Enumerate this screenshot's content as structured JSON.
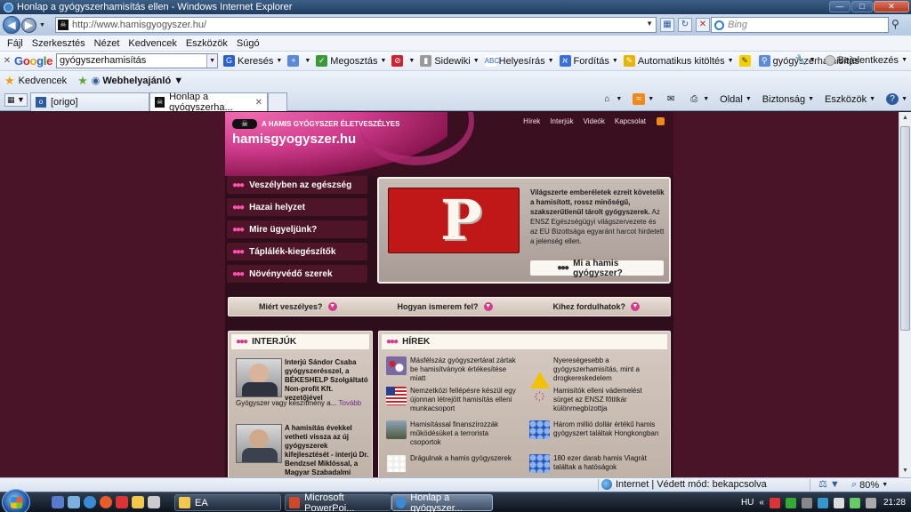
{
  "window": {
    "title": "Honlap a gyógyszerhamisítás ellen - Windows Internet Explorer"
  },
  "address": {
    "url": "http://www.hamisgyogyszer.hu/",
    "search_placeholder": "Bing"
  },
  "menu": [
    "Fájl",
    "Szerkesztés",
    "Nézet",
    "Kedvencek",
    "Eszközök",
    "Súgó"
  ],
  "google_toolbar": {
    "logo": "Google",
    "query": "gyógyszerhamisítás",
    "search_label": "Keresés",
    "share_label": "Megosztás",
    "sidewiki_label": "Sidewiki",
    "spell_label": "Helyesírás",
    "translate_label": "Fordítás",
    "autofill_label": "Automatikus kitöltés",
    "highlight_term": "gyógyszerhamisítás",
    "signin_label": "Bejelentkezés"
  },
  "favorites": {
    "favorites_label": "Kedvencek",
    "web_slice_label": "Webhelyajánló"
  },
  "tabs": [
    {
      "label": "[origo]"
    },
    {
      "label": "Honlap a gyógyszerha..."
    }
  ],
  "command_bar": {
    "page_label": "Oldal",
    "safety_label": "Biztonság",
    "tools_label": "Eszközök"
  },
  "site": {
    "tagline": "A HAMIS GYÓGYSZER ÉLETVESZÉLYES",
    "name": "hamisgyogyszer.hu",
    "top_nav": [
      "Hírek",
      "Interjúk",
      "Videók",
      "Kapcsolat"
    ],
    "side_nav": [
      "Veszélyben az egészség",
      "Hazai helyzet",
      "Mire ügyeljünk?",
      "Táplálék-kiegészítők",
      "Növényvédő szerek"
    ],
    "feature": {
      "headline": "Világszerte emberéletek ezreit követelik a hamisított, rossz minőségű, szakszerűtlenül tárolt gyógyszerek.",
      "body": " Az ENSZ Egészségügyi világszervezete és az EU Bizottsága egyaránt harcot hirdetett a jelenség ellen.",
      "button": "Mi a hamis gyógyszer?"
    },
    "questions": [
      "Miért veszélyes?",
      "Hogyan ismerem fel?",
      "Kihez fordulhatok?"
    ],
    "interviews_title": "INTERJÚK",
    "interviews": [
      {
        "title": "Interjú Sándor Csaba gyógyszerésszel, a BÉKESHELP Szolgáltató Non-profit Kft. vezetőjével",
        "body": "Gyógyszer vagy készítmény a...",
        "more": "Tovább"
      },
      {
        "title": "A hamisítás évekkel vetheti vissza az új gyógyszerek kifejlesztését - interjú Dr. Bendzsel Miklóssal, a Magyar Szabadalmi Hivatal",
        "body": "",
        "more": ""
      }
    ],
    "news_title": "HÍREK",
    "news": [
      "Másfélszáz gyógyszertárat zártak be hamisítványok értékesítése miatt",
      "Nyereségesebb a gyógyszerhamisítás, mint a drogkereskedelem",
      "Nemzetközi fellépésre készül egy újonnan létrejött hamisítás elleni munkacsoport",
      "Hamisítók elleni vádemelést sürget az ENSZ főtitkár különmegbízottja",
      "Hamisítással finanszírozzák működésüket a terrorista csoportok",
      "Három millió dollár értékű hamis gyógyszert találtak Hongkongban",
      "Drágulnak a hamis gyógyszerek",
      "180 ezer darab hamis Viagrát találtak a hatóságok"
    ]
  },
  "status": {
    "zone": "Internet | Védett mód: bekapcsolva",
    "zoom": "80%"
  },
  "taskbar": {
    "tasks": [
      "EA",
      "Microsoft PowerPoi...",
      "Honlap a gyógyszer..."
    ],
    "lang": "HU",
    "clock": "21:28"
  }
}
